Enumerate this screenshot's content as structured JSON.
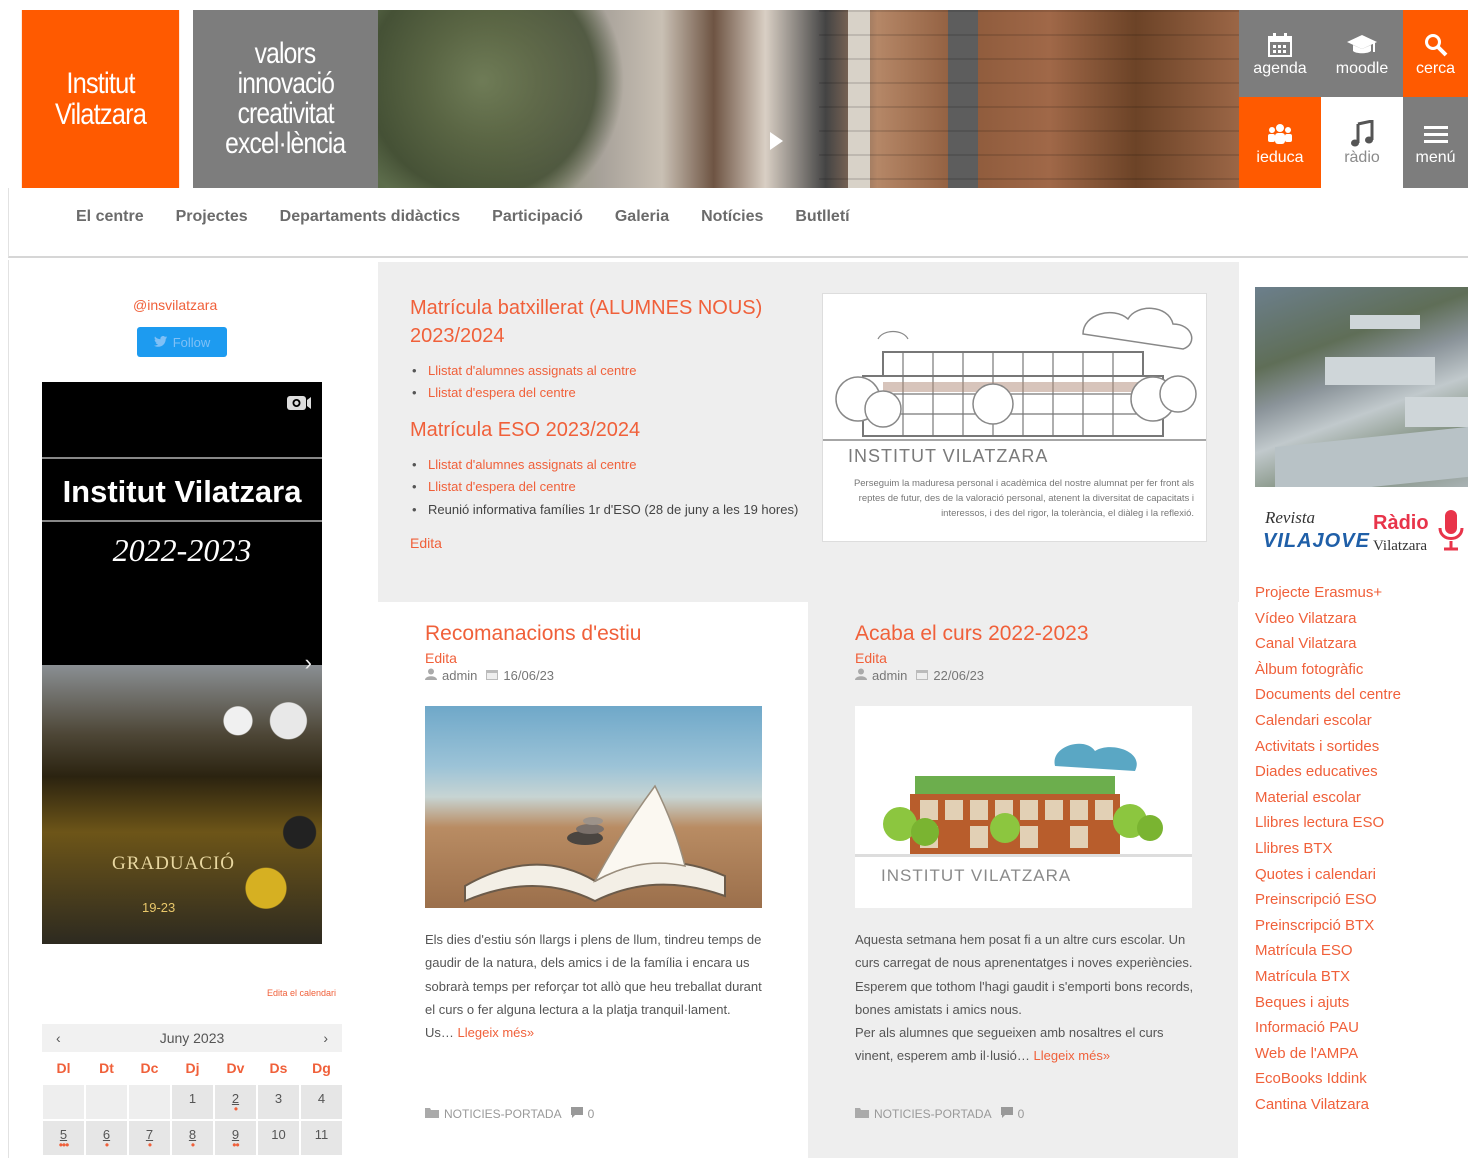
{
  "header": {
    "logo_line1": "Institut",
    "logo_line2": "Vilatzara",
    "values": [
      "valors",
      "innovació",
      "creativitat",
      "excel·lència"
    ],
    "tiles": [
      {
        "label": "agenda",
        "icon": "calendar-icon"
      },
      {
        "label": "moodle",
        "icon": "graduation-cap-icon"
      },
      {
        "label": "cerca",
        "icon": "search-icon"
      },
      {
        "label": "ieduca",
        "icon": "group-icon"
      },
      {
        "label": "ràdio",
        "icon": "music-note-icon"
      },
      {
        "label": "menú",
        "icon": "hamburger-icon"
      }
    ]
  },
  "nav": {
    "items": [
      "El centre",
      "Projectes",
      "Departaments didàctics",
      "Participació",
      "Galeria",
      "Notícies",
      "Butlletí"
    ]
  },
  "left": {
    "twitter_handle": "@insvilatzara",
    "follow_label": "Follow",
    "insta_title": "Institut Vilatzara",
    "insta_year": "2022-2023",
    "photo_text": "GRADUACIÓ",
    "photo_year": "19-23",
    "calendar_edit": "Edita el calendari",
    "calendar": {
      "month": "Juny 2023",
      "days": [
        "Dl",
        "Dt",
        "Dc",
        "Dj",
        "Dv",
        "Ds",
        "Dg"
      ],
      "week1": [
        "",
        "",
        "",
        "1",
        "2",
        "3",
        "4"
      ],
      "week2": [
        "5",
        "6",
        "7",
        "8",
        "9",
        "10",
        "11"
      ]
    }
  },
  "feature": {
    "title1": "Matrícula batxillerat (ALUMNES NOUS) 2023/2024",
    "list1": [
      "Llistat d'alumnes assignats al centre",
      "Llistat d'espera del centre"
    ],
    "title2": "Matrícula ESO 2023/2024",
    "list2": [
      "Llistat d'alumnes assignats al centre",
      "Llistat d'espera del centre"
    ],
    "note": "Reunió informativa famílies 1r d'ESO (28 de juny a les 19 hores)",
    "edit": "Edita",
    "image_caption": "INSTITUT VILATZARA",
    "image_quote": "Perseguim la maduresa personal i acadèmica del nostre alumnat per fer front als reptes de futur, des de la valoració personal, atenent la diversitat de capacitats i interessos, i des del rigor, la tolerància, el diàleg i la reflexió."
  },
  "posts": [
    {
      "title": "Recomanacions d'estiu",
      "edit": "Edita",
      "author": "admin",
      "date": "16/06/23",
      "text": "Els dies d'estiu són llargs i plens de llum, tindreu temps de gaudir de la natura, dels amics i de la família i encara us sobrarà temps per reforçar tot allò que heu treballat durant el curs o fer alguna lectura a la platja tranquil·lament.",
      "text2": "Us…",
      "more": "Llegeix més»",
      "category": "NOTICIES-PORTADA",
      "comments": "0"
    },
    {
      "title": "Acaba el curs 2022-2023",
      "edit": "Edita",
      "author": "admin",
      "date": "22/06/23",
      "text": "Aquesta setmana hem posat fi a un altre curs escolar. Un curs carregat de nous aprenentatges i noves experiències. Esperem que tothom l'hagi gaudit i s'emporti bons records, bones amistats i amics nous.",
      "text2": "Per als alumnes que segueixen amb nosaltres el curs vinent, esperem amb il·lusió…",
      "more": "Llegeix més»",
      "image_caption": "INSTITUT VILATZARA",
      "category": "NOTICIES-PORTADA",
      "comments": "0"
    }
  ],
  "right": {
    "revista": "Revista",
    "vilajove": "VILAJOVE",
    "radio": "Ràdio",
    "radio_sub": "Vilatzara",
    "links": [
      "Projecte Erasmus+",
      "Vídeo Vilatzara",
      "Canal Vilatzara",
      "Àlbum fotogràfic",
      "Documents del centre",
      "Calendari escolar",
      "Activitats i sortides",
      "Diades educatives",
      "Material escolar",
      "Llibres lectura ESO",
      "Llibres BTX",
      "Quotes i calendari",
      "Preinscripció ESO",
      "Preinscripció BTX",
      "Matrícula ESO",
      "Matrícula BTX",
      "Beques i ajuts",
      "Informació PAU",
      "Web de l'AMPA",
      "EcoBooks Iddink",
      "Cantina Vilatzara"
    ]
  },
  "colors": {
    "accent": "#ff5a00",
    "link": "#f0603a",
    "grey": "#7d7d7d",
    "panel": "#eeeeee"
  }
}
